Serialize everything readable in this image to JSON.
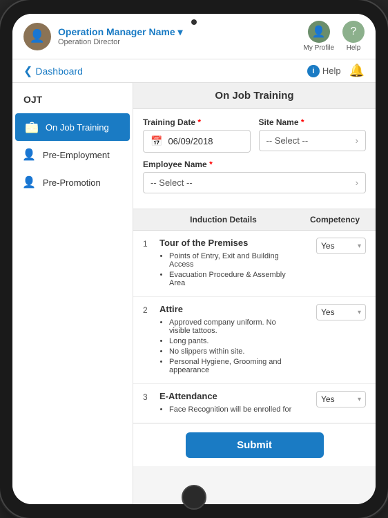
{
  "app": {
    "title": "On Job Training"
  },
  "header": {
    "user_name": "Operation Manager Name",
    "user_role": "Operation Director",
    "dropdown_arrow": "▾",
    "my_profile_label": "My Profile",
    "help_label": "Help"
  },
  "navbar": {
    "back_label": "Dashboard",
    "help_label": "Help",
    "back_arrow": "❮"
  },
  "sidebar": {
    "title": "OJT",
    "items": [
      {
        "label": "On Job Training",
        "active": true
      },
      {
        "label": "Pre-Employment",
        "active": false
      },
      {
        "label": "Pre-Promotion",
        "active": false
      }
    ]
  },
  "form": {
    "training_date_label": "Training Date",
    "training_date_value": "06/09/2018",
    "site_name_label": "Site Name",
    "site_name_placeholder": "-- Select --",
    "employee_name_label": "Employee Name",
    "employee_name_placeholder": "-- Select --"
  },
  "table": {
    "col_detail": "Induction Details",
    "col_competency": "Competency",
    "rows": [
      {
        "number": "1",
        "title": "Tour of the Premises",
        "bullets": [
          "Points of Entry, Exit and Building Access",
          "Evacuation Procedure & Assembly Area"
        ],
        "competency": "Yes"
      },
      {
        "number": "2",
        "title": "Attire",
        "bullets": [
          "Approved company uniform. No visible tattoos.",
          "Long pants.",
          "No slippers within site.",
          "Personal Hygiene, Grooming and appearance"
        ],
        "competency": "Yes"
      },
      {
        "number": "3",
        "title": "E-Attendance",
        "bullets": [
          "Face Recognition will be enrolled for"
        ],
        "competency": "Yes"
      }
    ]
  },
  "submit": {
    "label": "Submit"
  }
}
